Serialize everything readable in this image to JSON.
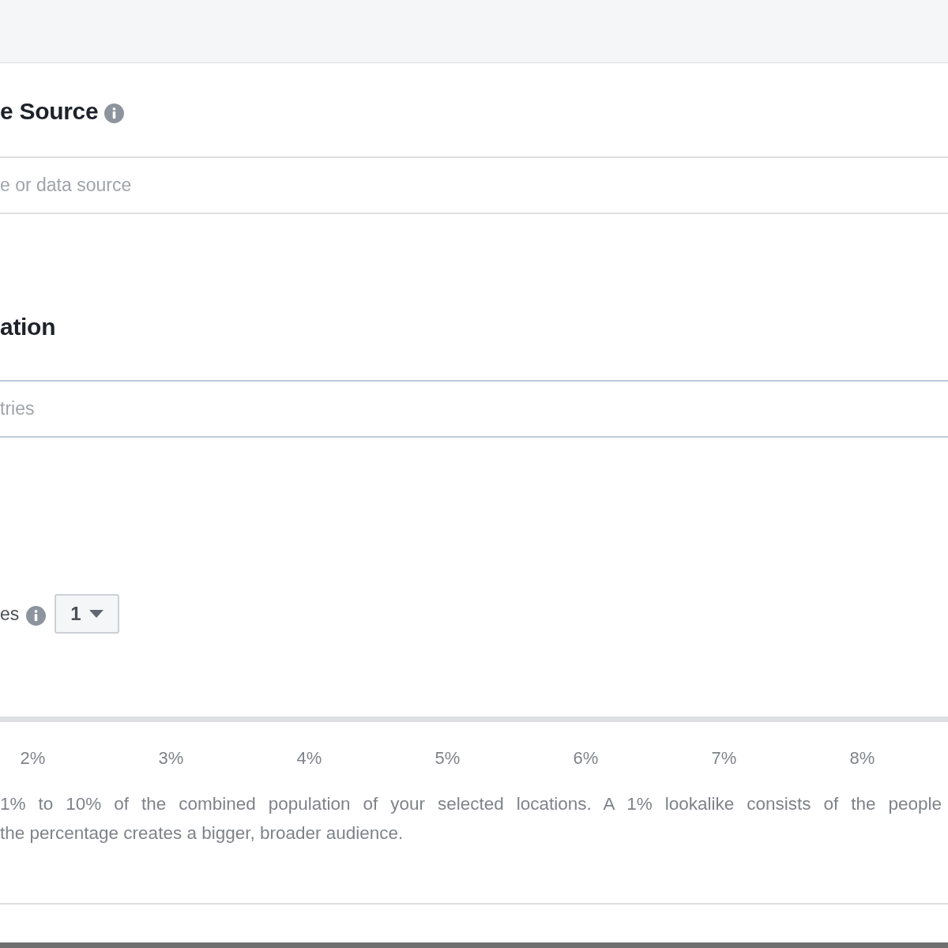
{
  "source_section": {
    "title": "e Source",
    "field": {
      "placeholder": "e or data source"
    }
  },
  "location_section": {
    "title": "ation",
    "field": {
      "placeholder": "tries"
    }
  },
  "audience_count": {
    "label": "es",
    "dropdown": {
      "value": "1"
    }
  },
  "size_slider": {
    "ticks": [
      "2%",
      "3%",
      "4%",
      "5%",
      "6%",
      "7%",
      "8%"
    ]
  },
  "description": [
    "1% to 10% of the combined population of your selected locations. A 1% lookalike consists of the people",
    "the percentage creates a bigger, broader audience."
  ]
}
